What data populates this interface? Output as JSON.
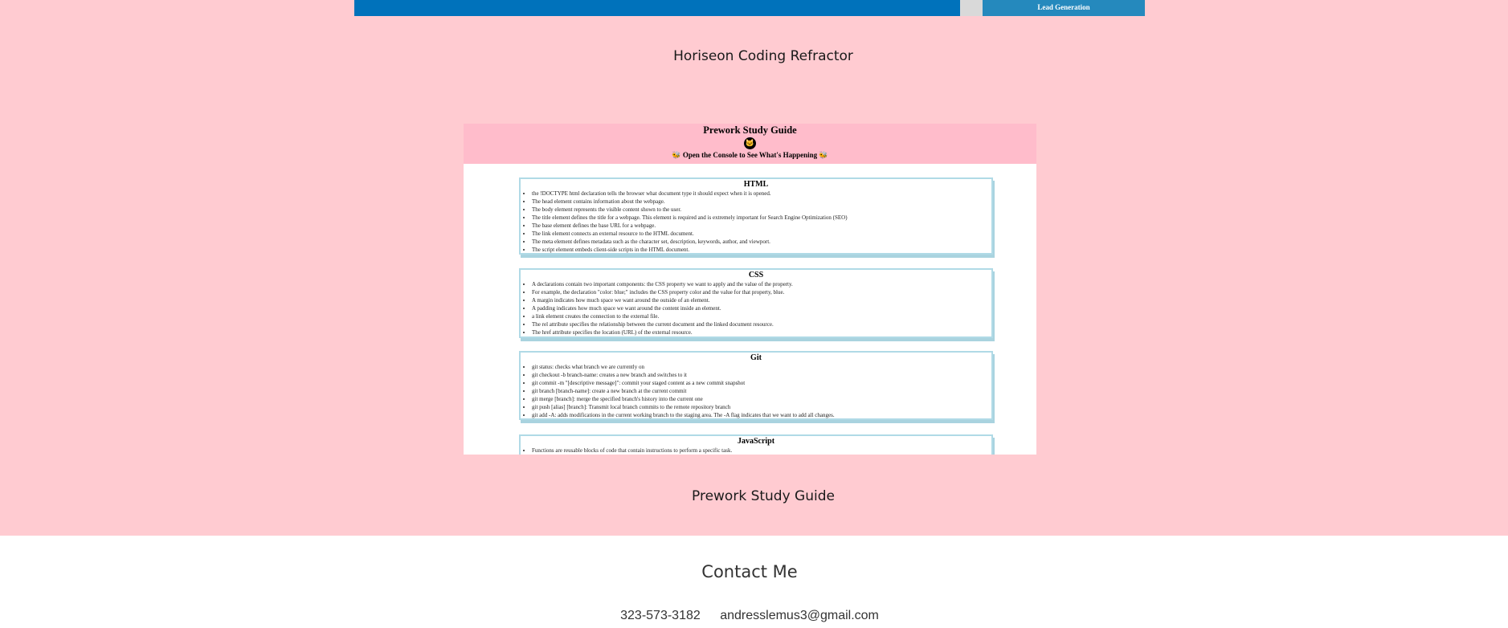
{
  "top_strip": {
    "button_label": "Lead Generation",
    "accent_color": "#0072bb"
  },
  "project": {
    "title": "Horiseon Coding Refractor",
    "second_title": "Prework Study Guide"
  },
  "guide": {
    "title": "Prework Study Guide",
    "subtitle": "🐝 Open the Console to See What's Happening 🐝",
    "sections": [
      {
        "heading": "HTML",
        "items": [
          "the !DOCTYPE html declaration tells the browser what document type it should expect when it is opened.",
          "The head element contains information about the webpage.",
          "The body element represents the visible content shown to the user.",
          "The title element defines the title for a webpage. This element is required and is extremely important for Search Engine Optimization (SEO)",
          "The base element defines the base URL for a webpage.",
          "The link element connects an external resource to the HTML document.",
          "The meta element defines metadata such as the character set, description, keywords, author, and viewport.",
          "The script element embeds client-side scripts in the HTML document."
        ]
      },
      {
        "heading": "CSS",
        "items": [
          "A declarations contain two important components: the CSS property we want to apply and the value of the property.",
          "For example, the declaration \"color: blue;\" includes the CSS property color and the value for that property, blue.",
          "A margin indicates how much space we want around the outside of an element.",
          "A padding indicates how much space we want around the content inside an element.",
          "a link element creates the connection to the external file.",
          "The rel attribute specifies the relationship between the current document and the linked document resource.",
          "The href attribute specifies the location (URL) of the external resource."
        ]
      },
      {
        "heading": "Git",
        "items": [
          "git status: checks what branch we are currently on",
          "git checkout -b branch-name: creates a new branch and switches to it",
          "git commit -m \"[descriptive message]\": commit your staged content as a new commit snapshot",
          "git branch [branch-name]: create a new branch at the current commit",
          "git merge [branch]: merge the specified branch's history into the current one",
          "git push [alias] [branch]: Transmit local branch commits to the remote repository branch",
          "git add -A: adds modifications in the current working branch to the staging area. The -A flag indicates that we want to add all changes."
        ]
      },
      {
        "heading": "JavaScript",
        "items": [
          "Functions are reusable blocks of code that contain instructions to perform a specific task."
        ]
      }
    ]
  },
  "contact": {
    "heading": "Contact Me",
    "phone": "323-573-3182",
    "email": "andresslemus3@gmail.com"
  }
}
